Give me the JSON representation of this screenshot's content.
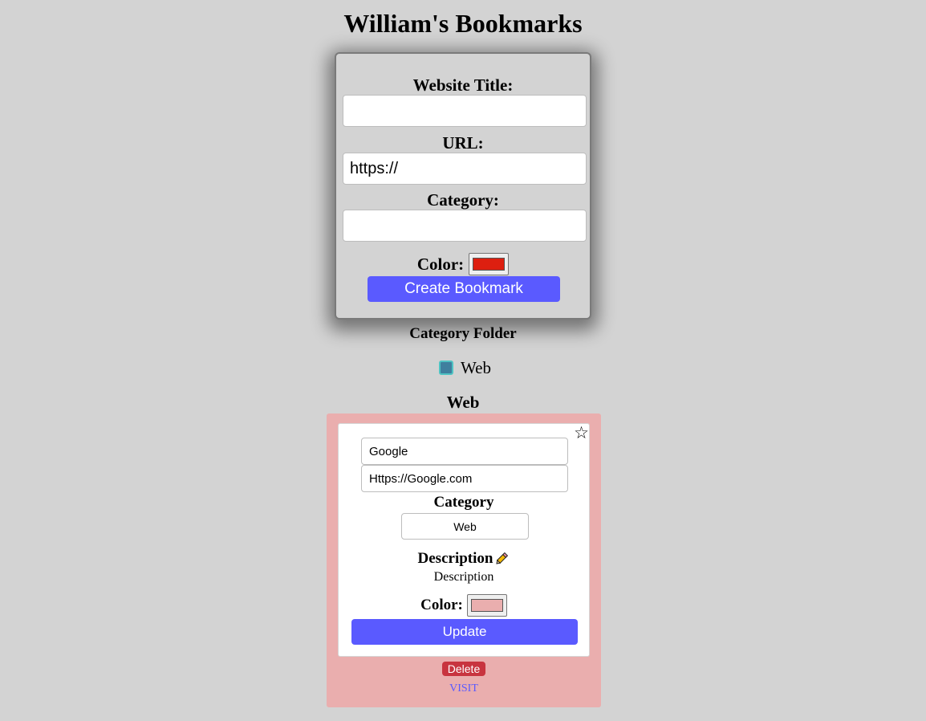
{
  "page": {
    "title": "William's Bookmarks"
  },
  "create_form": {
    "title_label": "Website Title:",
    "title_value": "",
    "url_label": "URL:",
    "url_value": "https://",
    "category_label": "Category:",
    "category_value": "",
    "color_label": "Color:",
    "color_value": "#dd1f10",
    "submit_label": "Create Bookmark"
  },
  "category_folder": {
    "heading": "Category Folder",
    "items": [
      {
        "label": "Web",
        "color": "#3f7f9e",
        "border_color": "#4ec3c3"
      }
    ]
  },
  "category_section": {
    "heading": "Web",
    "bookmarks": [
      {
        "title": "Google",
        "url": "Https://Google.com",
        "category_label": "Category",
        "category_value": "Web",
        "description_label": "Description",
        "description_icon": "pencil-icon",
        "description_text": "Description",
        "color_label": "Color:",
        "color_value": "#eaaeae",
        "update_label": "Update",
        "delete_label": "Delete",
        "visit_label": "VISIT",
        "favorite_icon": "star-outline-icon"
      }
    ]
  },
  "colors": {
    "background": "#d3d3d3",
    "primary_button": "#5a5aff",
    "delete_button": "#c8343f",
    "card_background": "#eaaeae"
  }
}
